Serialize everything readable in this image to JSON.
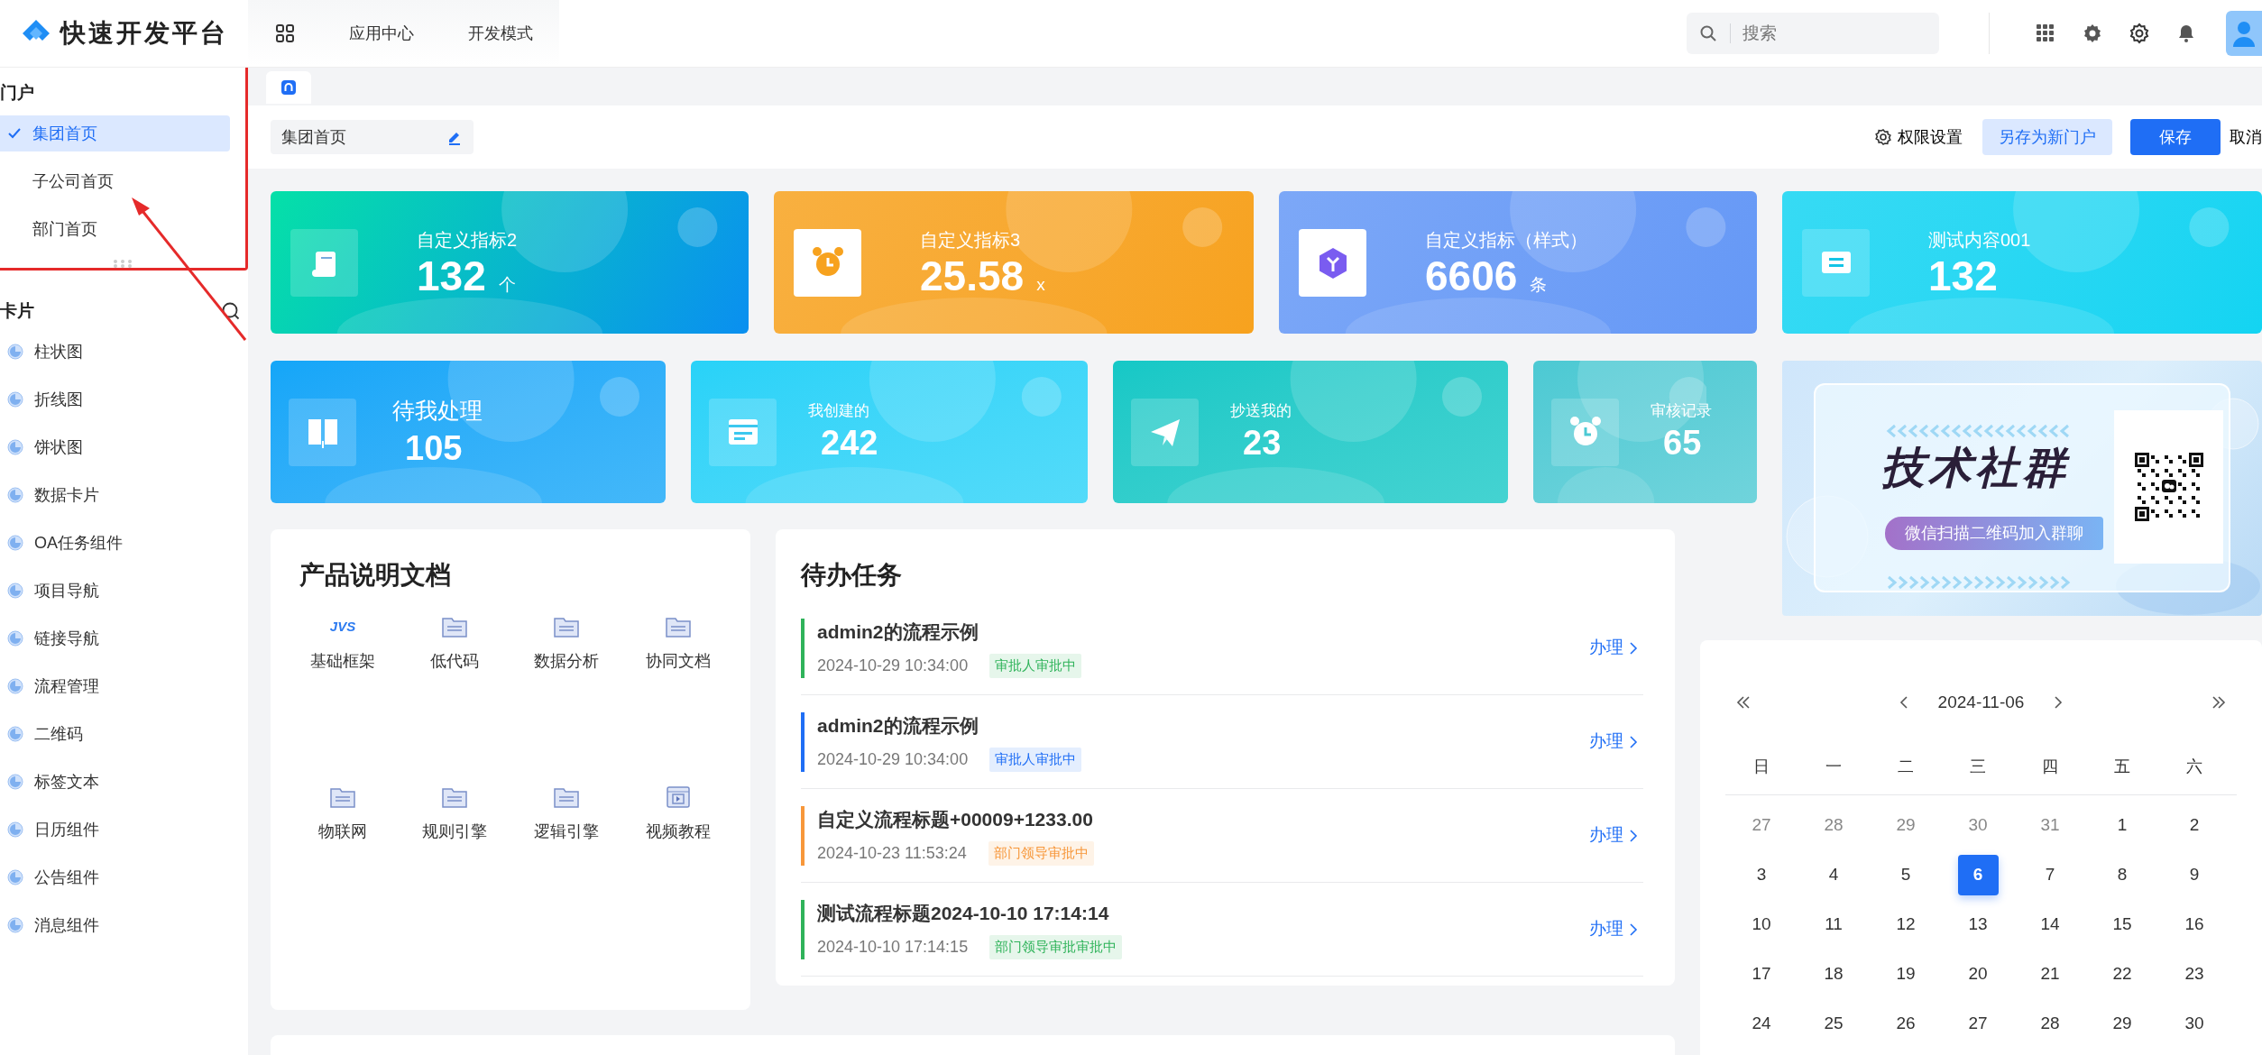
{
  "header": {
    "logo_text": "快速开发平台",
    "nav": [
      {
        "label": "应用中心"
      },
      {
        "label": "开发模式"
      }
    ],
    "search": {
      "placeholder": "搜索"
    }
  },
  "sidebar": {
    "sections": [
      {
        "kind": "portal",
        "title": "门户",
        "items": [
          {
            "label": "集团首页",
            "selected": true
          },
          {
            "label": "子公司首页",
            "selected": false
          },
          {
            "label": "部门首页",
            "selected": false
          }
        ]
      },
      {
        "kind": "widgets",
        "title": "卡片",
        "items": [
          {
            "label": "柱状图"
          },
          {
            "label": "折线图"
          },
          {
            "label": "饼状图"
          },
          {
            "label": "数据卡片"
          },
          {
            "label": "OA任务组件"
          },
          {
            "label": "项目导航"
          },
          {
            "label": "链接导航"
          },
          {
            "label": "流程管理"
          },
          {
            "label": "二维码"
          },
          {
            "label": "标签文本"
          },
          {
            "label": "日历组件"
          },
          {
            "label": "公告组件"
          },
          {
            "label": "消息组件"
          }
        ]
      }
    ]
  },
  "toolbar": {
    "portal_name": "集团首页",
    "permission_label": "权限设置",
    "buttons": [
      {
        "label": "另存为新门户",
        "kind": "secondary"
      },
      {
        "label": "保存",
        "kind": "primary"
      },
      {
        "label": "取消",
        "kind": "text"
      }
    ]
  },
  "stats": [
    {
      "title": "自定义指标2",
      "value": "132",
      "unit": "个",
      "color": "#0a8ff0"
    },
    {
      "title": "自定义指标3",
      "value": "25.58",
      "unit": "x",
      "color": "#f7a21e"
    },
    {
      "title": "自定义指标（样式）",
      "value": "6606",
      "unit": "条",
      "color": "#6598f6"
    },
    {
      "title": "测试内容001",
      "value": "132",
      "color": "#13d4f2"
    }
  ],
  "quick_stats": [
    {
      "title": "待我处理",
      "value": "105",
      "color": "#14a6f8"
    },
    {
      "title": "我创建的",
      "value": "242",
      "color": "#28d2f8"
    },
    {
      "title": "抄送我的",
      "value": "23",
      "color": "#15c8c6"
    },
    {
      "title": "审核记录",
      "value": "65",
      "color": "#4cc9d3"
    }
  ],
  "banner": {
    "title": "技术社群",
    "subtitle": "微信扫描二维码加入群聊"
  },
  "docs": {
    "title": "产品说明文档",
    "items": [
      {
        "label": "基础框架",
        "kind": "logo",
        "logo_text": "JVS"
      },
      {
        "label": "低代码",
        "kind": "folder"
      },
      {
        "label": "数据分析",
        "kind": "folder"
      },
      {
        "label": "协同文档",
        "kind": "folder"
      },
      {
        "label": "物联网",
        "kind": "folder"
      },
      {
        "label": "规则引擎",
        "kind": "folder"
      },
      {
        "label": "逻辑引擎",
        "kind": "folder"
      },
      {
        "label": "视频教程",
        "kind": "video"
      }
    ]
  },
  "tasks": {
    "title": "待办任务",
    "items": [
      {
        "title": "admin2的流程示例",
        "time": "2024-10-29 10:34:00",
        "status": "审批人审批中",
        "color": "#2fb35a",
        "action": "办理"
      },
      {
        "title": "admin2的流程示例",
        "time": "2024-10-29 10:34:00",
        "status": "审批人审批中",
        "color": "#1f6ef5",
        "action": "办理"
      },
      {
        "title": "自定义流程标题+00009+1233.00",
        "time": "2024-10-23 11:53:24",
        "status": "部门领导审批中",
        "color": "#f7973a",
        "action": "办理"
      },
      {
        "title": "测试流程标题2024-10-10 17:14:14",
        "time": "2024-10-10 17:14:15",
        "status": "部门领导审批审批中",
        "color": "#2fb35a",
        "action": "办理"
      }
    ]
  },
  "calendar": {
    "date": "2024-11-06",
    "weekdays": [
      "日",
      "一",
      "二",
      "三",
      "四",
      "五",
      "六"
    ],
    "weeks": [
      [
        {
          "day": "27",
          "muted": true,
          "selected": false
        },
        {
          "day": "28",
          "muted": true,
          "selected": false
        },
        {
          "day": "29",
          "muted": true,
          "selected": false
        },
        {
          "day": "30",
          "muted": true,
          "selected": false
        },
        {
          "day": "31",
          "muted": true,
          "selected": false
        },
        {
          "day": "1",
          "muted": false,
          "selected": false
        },
        {
          "day": "2",
          "muted": false,
          "selected": false
        }
      ],
      [
        {
          "day": "3",
          "muted": false,
          "selected": false
        },
        {
          "day": "4",
          "muted": false,
          "selected": false
        },
        {
          "day": "5",
          "muted": false,
          "selected": false
        },
        {
          "day": "6",
          "muted": false,
          "selected": true
        },
        {
          "day": "7",
          "muted": false,
          "selected": false
        },
        {
          "day": "8",
          "muted": false,
          "selected": false
        },
        {
          "day": "9",
          "muted": false,
          "selected": false
        }
      ],
      [
        {
          "day": "10",
          "muted": false,
          "selected": false
        },
        {
          "day": "11",
          "muted": false,
          "selected": false
        },
        {
          "day": "12",
          "muted": false,
          "selected": false
        },
        {
          "day": "13",
          "muted": false,
          "selected": false
        },
        {
          "day": "14",
          "muted": false,
          "selected": false
        },
        {
          "day": "15",
          "muted": false,
          "selected": false
        },
        {
          "day": "16",
          "muted": false,
          "selected": false
        }
      ],
      [
        {
          "day": "17",
          "muted": false,
          "selected": false
        },
        {
          "day": "18",
          "muted": false,
          "selected": false
        },
        {
          "day": "19",
          "muted": false,
          "selected": false
        },
        {
          "day": "20",
          "muted": false,
          "selected": false
        },
        {
          "day": "21",
          "muted": false,
          "selected": false
        },
        {
          "day": "22",
          "muted": false,
          "selected": false
        },
        {
          "day": "23",
          "muted": false,
          "selected": false
        }
      ],
      [
        {
          "day": "24",
          "muted": false,
          "selected": false
        },
        {
          "day": "25",
          "muted": false,
          "selected": false
        },
        {
          "day": "26",
          "muted": false,
          "selected": false
        },
        {
          "day": "27",
          "muted": false,
          "selected": false
        },
        {
          "day": "28",
          "muted": false,
          "selected": false
        },
        {
          "day": "29",
          "muted": false,
          "selected": false
        },
        {
          "day": "30",
          "muted": false,
          "selected": false
        }
      ]
    ]
  }
}
